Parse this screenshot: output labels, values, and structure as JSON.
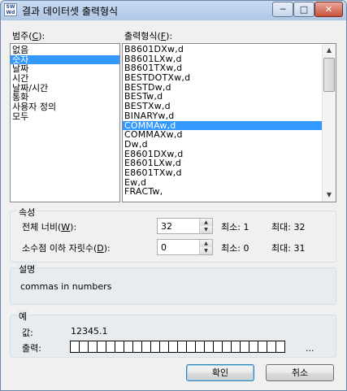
{
  "window": {
    "title": "결과 데이터셋 출력형식",
    "app_icon_text": "SW\nWd",
    "minimize_symbol": "─",
    "maximize_symbol": "□",
    "close_symbol": "✕"
  },
  "category": {
    "label": "범주(",
    "mnemonic": "C",
    "label_end": "):",
    "items": [
      "없음",
      "숫자",
      "날짜",
      "시간",
      "날짜/시간",
      "통화",
      "사용자 정의",
      "모두"
    ],
    "selected_index": 1
  },
  "format": {
    "label": "출력형식(",
    "mnemonic": "F",
    "label_end": "):",
    "items": [
      "B8601DXw,d",
      "B8601LXw,d",
      "B8601TXw,d",
      "BESTDOTXw,d",
      "BESTDw,d",
      "BESTw,d",
      "BESTXw,d",
      "BINARYw,d",
      "COMMAw,d",
      "COMMAXw,d",
      "Dw,d",
      "E8601DXw,d",
      "E8601LXw,d",
      "E8601TXw,d",
      "Ew,d",
      "FRACTw,"
    ],
    "selected_index": 8,
    "scroll_up": "▲",
    "scroll_down": "▼"
  },
  "attributes": {
    "title": "속성",
    "total_width_label": "전체 너비(",
    "total_width_mnemonic": "W",
    "total_width_label_end": "):",
    "total_width_value": "32",
    "total_width_min": "최소: 1",
    "total_width_max": "최대: 32",
    "decimal_label": "소수점 이하 자릿수(",
    "decimal_mnemonic": "D",
    "decimal_label_end": "):",
    "decimal_value": "0",
    "decimal_min": "최소: 0",
    "decimal_max": "최대: 31",
    "spin_up": "▲",
    "spin_down": "▼"
  },
  "description": {
    "title": "설명",
    "text": "commas in numbers"
  },
  "example": {
    "title": "예",
    "value_label": "값:",
    "value": "12345.1",
    "output_label": "출력:",
    "output_cell_count": 24,
    "ellipsis": "..."
  },
  "buttons": {
    "ok": "확인",
    "cancel": "취소"
  }
}
